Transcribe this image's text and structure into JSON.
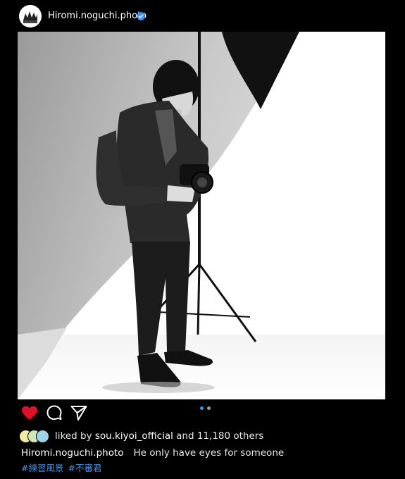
{
  "post": {
    "username": "Hiromi.noguchi.photo",
    "verified_icon": "verified-badge-icon",
    "image_icon": "illustration-photographer-with-camera",
    "carousel": {
      "total": 2,
      "active": 1
    }
  },
  "actions": {
    "like_icon": "heart-icon",
    "comment_icon": "comment-icon",
    "share_icon": "send-icon",
    "like_color": "#e0102a"
  },
  "likes": {
    "prefix": "liked by",
    "user": "sou.kiyoi_official",
    "conjunction": "and",
    "others": "11,180 others"
  },
  "caption": {
    "user": "Hiromi.noguchi.photo",
    "text": "He only have eyes for someone"
  },
  "hashtags": [
    "#練習風景",
    "#不審君"
  ],
  "colors": {
    "background": "#000000",
    "hashtag": "#4a8ee0",
    "verified": "#3897f0",
    "dot_active": "#3897f0",
    "dot_inactive": "#a0a0a0"
  }
}
